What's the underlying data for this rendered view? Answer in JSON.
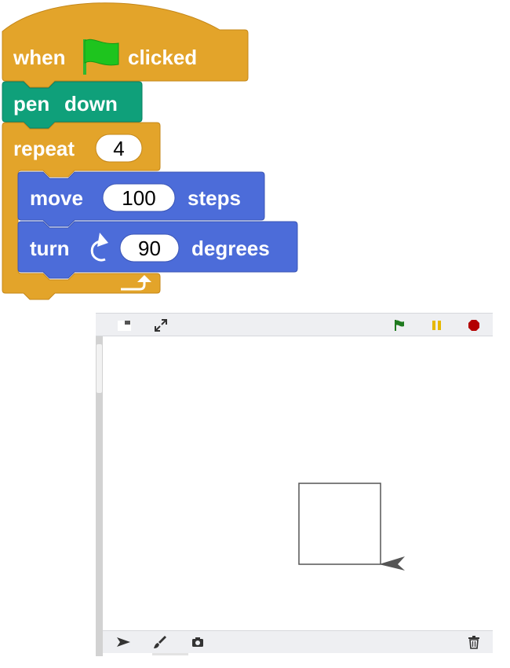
{
  "script": {
    "hat_block": {
      "when": "when",
      "flag_icon": "green-flag-icon",
      "clicked": "clicked",
      "color": "#e3a42a"
    },
    "pen_block": {
      "label_1": "pen",
      "label_2": "down",
      "color": "#0fa07a"
    },
    "repeat_block": {
      "label": "repeat",
      "times": "4",
      "color": "#e3a42a"
    },
    "move_block": {
      "label": "move",
      "steps_value": "100",
      "steps_label": "steps",
      "color": "#4c6cd9"
    },
    "turn_block": {
      "label": "turn",
      "rotate_icon": "rotate-right-icon",
      "degrees_value": "90",
      "degrees_label": "degrees",
      "color": "#4c6cd9"
    }
  },
  "stage": {
    "toolbar": {
      "left_icons": [
        "small-stage-icon",
        "fullscreen-icon"
      ],
      "right_icons": [
        "green-flag-icon",
        "pause-icon",
        "stop-icon"
      ],
      "colors": {
        "flag": "#1f7a1f",
        "pause": "#e6b800",
        "stop": "#b30000"
      }
    },
    "bottom_toolbar": {
      "left_icons": [
        "arrow-icon",
        "paintbrush-icon",
        "camera-icon"
      ],
      "right_icons": [
        "trash-icon"
      ]
    },
    "drawing": {
      "shape": "square",
      "stroke": "#555555",
      "sprite": "arrow-sprite-icon"
    }
  }
}
